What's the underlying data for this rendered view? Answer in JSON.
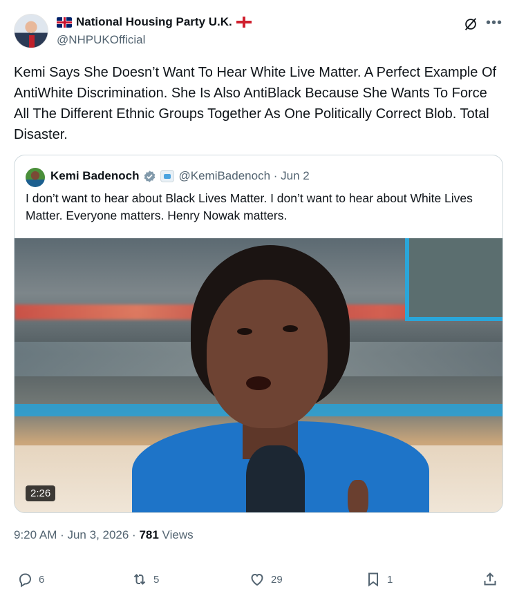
{
  "post": {
    "author_name": "National Housing Party U.K.",
    "handle": "@NHPUKOfficial",
    "text": "Kemi Says She Doesn’t Want To Hear White Live Matter.  A Perfect Example Of AntiWhite Discrimination.  She Is Also AntiBlack Because She Wants To Force All The Different Ethnic Groups Together As One Politically Correct Blob.  Total Disaster.",
    "time": "9:20 AM · Jun 3, 2026 · ",
    "views_count": "781",
    "views_label": " Views"
  },
  "quote": {
    "author_name": "Kemi Badenoch",
    "handle_date": "@KemiBadenoch · Jun 2",
    "text": "I don’t want to hear about Black Lives Matter. I don’t want to hear about White Lives Matter. Everyone matters. Henry Nowak matters.",
    "video_duration": "2:26"
  },
  "actions": {
    "replies": "6",
    "reposts": "5",
    "likes": "29",
    "bookmarks": "1"
  },
  "icons": {
    "header": [
      "uk-flag-icon",
      "england-flag-icon",
      "grok-icon",
      "more-icon"
    ],
    "quote": [
      "verified-badge-icon",
      "government-badge-icon"
    ],
    "actions": [
      "reply-icon",
      "repost-icon",
      "like-icon",
      "bookmark-icon",
      "share-icon"
    ]
  },
  "colors": {
    "text": "#0f1419",
    "secondary": "#536471",
    "border": "#cfd9de",
    "verified": "#829aab"
  }
}
